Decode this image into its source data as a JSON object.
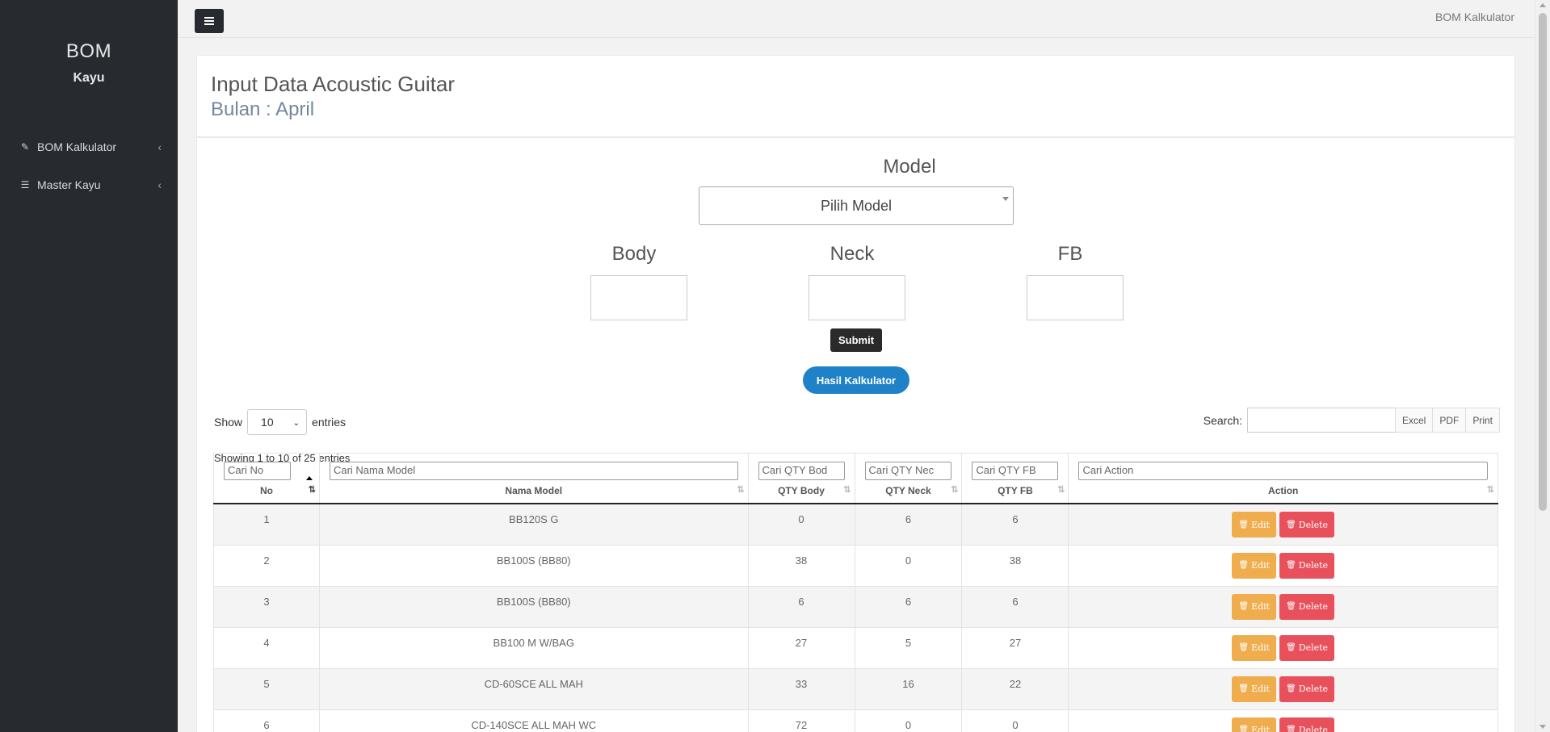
{
  "sidebar": {
    "brand_title": "BOM",
    "brand_sub": "Kayu",
    "items": [
      {
        "label": "BOM Kalkulator",
        "icon": "pencil-icon"
      },
      {
        "label": "Master Kayu",
        "icon": "list-icon"
      }
    ]
  },
  "topbar": {
    "title": "BOM Kalkulator"
  },
  "header": {
    "title": "Input Data Acoustic Guitar",
    "subtitle": "Bulan : April"
  },
  "form": {
    "model_label": "Model",
    "model_select_value": "Pilih Model",
    "body_label": "Body",
    "neck_label": "Neck",
    "fb_label": "FB",
    "submit_label": "Submit",
    "hasil_label": "Hasil Kalkulator"
  },
  "table_controls": {
    "show_label": "Show",
    "length_value": "10",
    "entries_label": "entries",
    "info": "Showing 1 to 10 of 25 entries",
    "search_label": "Search:",
    "buttons": [
      "Excel",
      "PDF",
      "Print"
    ]
  },
  "table": {
    "columns": [
      {
        "label": "No",
        "filter": "Cari No"
      },
      {
        "label": "Nama Model",
        "filter": "Cari Nama Model"
      },
      {
        "label": "QTY Body",
        "filter": "Cari QTY Bod"
      },
      {
        "label": "QTY Neck",
        "filter": "Cari QTY Nec"
      },
      {
        "label": "QTY FB",
        "filter": "Cari QTY FB"
      },
      {
        "label": "Action",
        "filter": "Cari Action"
      }
    ],
    "edit_label": "Edit",
    "delete_label": "Delete",
    "rows": [
      {
        "no": "1",
        "model": "BB120S G",
        "body": "0",
        "neck": "6",
        "fb": "6"
      },
      {
        "no": "2",
        "model": "BB100S (BB80)",
        "body": "38",
        "neck": "0",
        "fb": "38"
      },
      {
        "no": "3",
        "model": "BB100S (BB80)",
        "body": "6",
        "neck": "6",
        "fb": "6"
      },
      {
        "no": "4",
        "model": "BB100 M W/BAG",
        "body": "27",
        "neck": "5",
        "fb": "27"
      },
      {
        "no": "5",
        "model": "CD-60SCE ALL MAH",
        "body": "33",
        "neck": "16",
        "fb": "22"
      },
      {
        "no": "6",
        "model": "CD-140SCE ALL MAH WC",
        "body": "72",
        "neck": "0",
        "fb": "0"
      }
    ]
  }
}
